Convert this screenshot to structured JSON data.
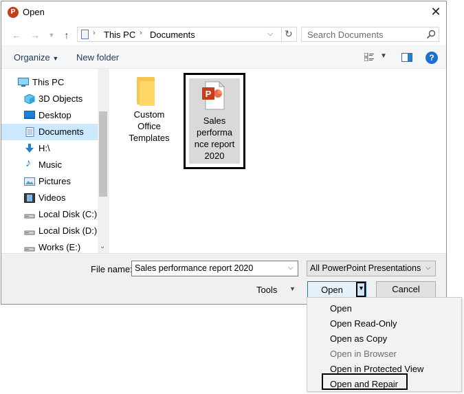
{
  "window": {
    "title": "Open",
    "app_icon_letter": "P"
  },
  "address_bar": {
    "crumbs": [
      "This PC",
      "Documents"
    ],
    "search_placeholder": "Search Documents"
  },
  "toolbar": {
    "organize_label": "Organize",
    "new_folder_label": "New folder",
    "help_label": "?"
  },
  "nav_pane": {
    "items": [
      {
        "label": "This PC",
        "icon": "monitor-icon"
      },
      {
        "label": "3D Objects",
        "icon": "cube-icon"
      },
      {
        "label": "Desktop",
        "icon": "desktop-icon"
      },
      {
        "label": "Documents",
        "icon": "documents-icon",
        "selected": true
      },
      {
        "label": "H:\\",
        "icon": "download-arrow-icon"
      },
      {
        "label": "Music",
        "icon": "music-note-icon"
      },
      {
        "label": "Pictures",
        "icon": "pictures-icon"
      },
      {
        "label": "Videos",
        "icon": "film-icon"
      },
      {
        "label": "Local Disk (C:)",
        "icon": "drive-icon"
      },
      {
        "label": "Local Disk (D:)",
        "icon": "drive-icon"
      },
      {
        "label": "Works (E:)",
        "icon": "drive-icon"
      }
    ]
  },
  "files": {
    "folder_label_lines": [
      "Custom",
      "Office",
      "Templates"
    ],
    "ppt_label_lines": [
      "Sales",
      "performa",
      "nce report",
      "2020"
    ],
    "ppt_icon_letter": "P"
  },
  "bottom": {
    "file_name_label": "File name:",
    "file_name_value": "Sales performance report 2020",
    "file_type_value": "All PowerPoint Presentations",
    "tools_label": "Tools",
    "open_label": "Open",
    "cancel_label": "Cancel"
  },
  "open_menu": {
    "items": [
      {
        "label": "Open",
        "disabled": false
      },
      {
        "label": "Open Read-Only",
        "disabled": false
      },
      {
        "label": "Open as Copy",
        "disabled": false
      },
      {
        "label": "Open in Browser",
        "disabled": true
      },
      {
        "label": "Open in Protected View",
        "disabled": false
      },
      {
        "label": "Open and Repair",
        "disabled": false,
        "highlighted": true
      }
    ]
  },
  "colors": {
    "accent": "#0078d7",
    "selection": "#cce8ff",
    "powerpoint": "#c43e1c"
  }
}
